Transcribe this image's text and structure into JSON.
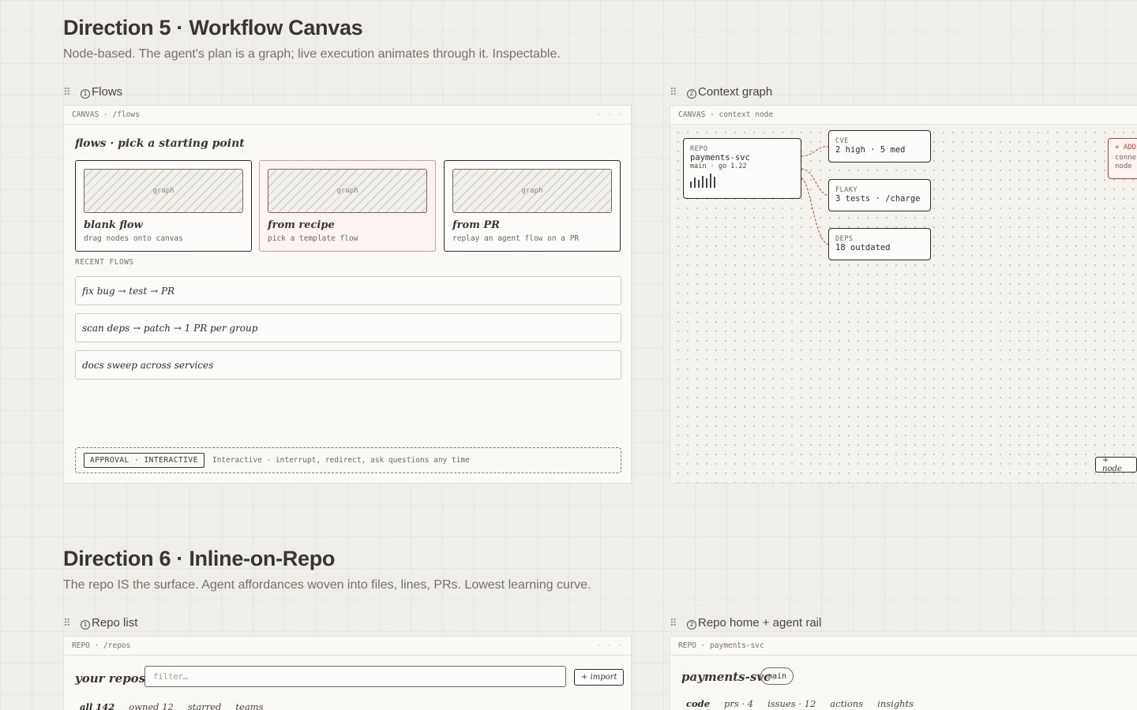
{
  "direction5": {
    "title": "Direction 5 · Workflow Canvas",
    "subtitle": "Node-based. The agent's plan is a graph; live execution animates through it. Inspectable."
  },
  "direction6": {
    "title": "Direction 6 · Inline-on-Repo",
    "subtitle": "The repo IS the surface. Agent affordances woven into files, lines, PRs. Lowest learning curve."
  },
  "flows_panel": {
    "number": "1",
    "label": "Flows",
    "bar_text": "CANVAS · /flows",
    "heading": "flows · pick a starting point",
    "start_cards": [
      {
        "thumb": "graph",
        "title": "blank flow",
        "sub": "drag nodes onto canvas"
      },
      {
        "thumb": "graph",
        "title": "from recipe",
        "sub": "pick a template flow"
      },
      {
        "thumb": "graph",
        "title": "from PR",
        "sub": "replay an agent flow on a PR"
      }
    ],
    "recent_label": "RECENT FLOWS",
    "recent": [
      "fix bug → test → PR",
      "scan deps → patch → 1 PR per group",
      "docs sweep across services"
    ],
    "mode_badge": "APPROVAL · INTERACTIVE",
    "mode_text": "Interactive · interrupt, redirect, ask questions any time"
  },
  "context_panel": {
    "number": "2",
    "label": "Context graph",
    "bar_text": "CANVAS · context node",
    "repo_node": {
      "key": "REPO",
      "name": "payments-svc",
      "meta": "main · go 1.22",
      "activity": [
        0.45,
        0.7,
        0.55,
        0.85,
        0.65,
        1.0,
        0.8
      ]
    },
    "side_nodes": [
      {
        "key": "CVE",
        "value": "2 high · 5 med"
      },
      {
        "key": "FLAKY",
        "value": "3 tests · /charge"
      },
      {
        "key": "DEPS",
        "value": "18 outdated"
      }
    ],
    "alert_node": {
      "title": "+ ADD",
      "line1": "conne",
      "line2": "node"
    },
    "add_node_label": "+ node"
  },
  "repo_list_panel": {
    "number": "1",
    "label": "Repo list",
    "bar_text": "REPO · /repos",
    "heading": "your repos",
    "filter_placeholder": "filter…",
    "import_label": "+ import",
    "tabs": [
      "all 142",
      "owned 12",
      "starred",
      "teams"
    ]
  },
  "repo_home_panel": {
    "number": "2",
    "label": "Repo home + agent rail",
    "bar_text": "REPO · payments-svc",
    "title": "payments-svc",
    "branch": "main",
    "tabs": [
      "code",
      "prs · 4",
      "issues · 12",
      "actions",
      "insights"
    ]
  },
  "colors": {
    "accent_red": "#c0463a",
    "ink": "#2e2a26",
    "paper": "#faf9f5"
  }
}
